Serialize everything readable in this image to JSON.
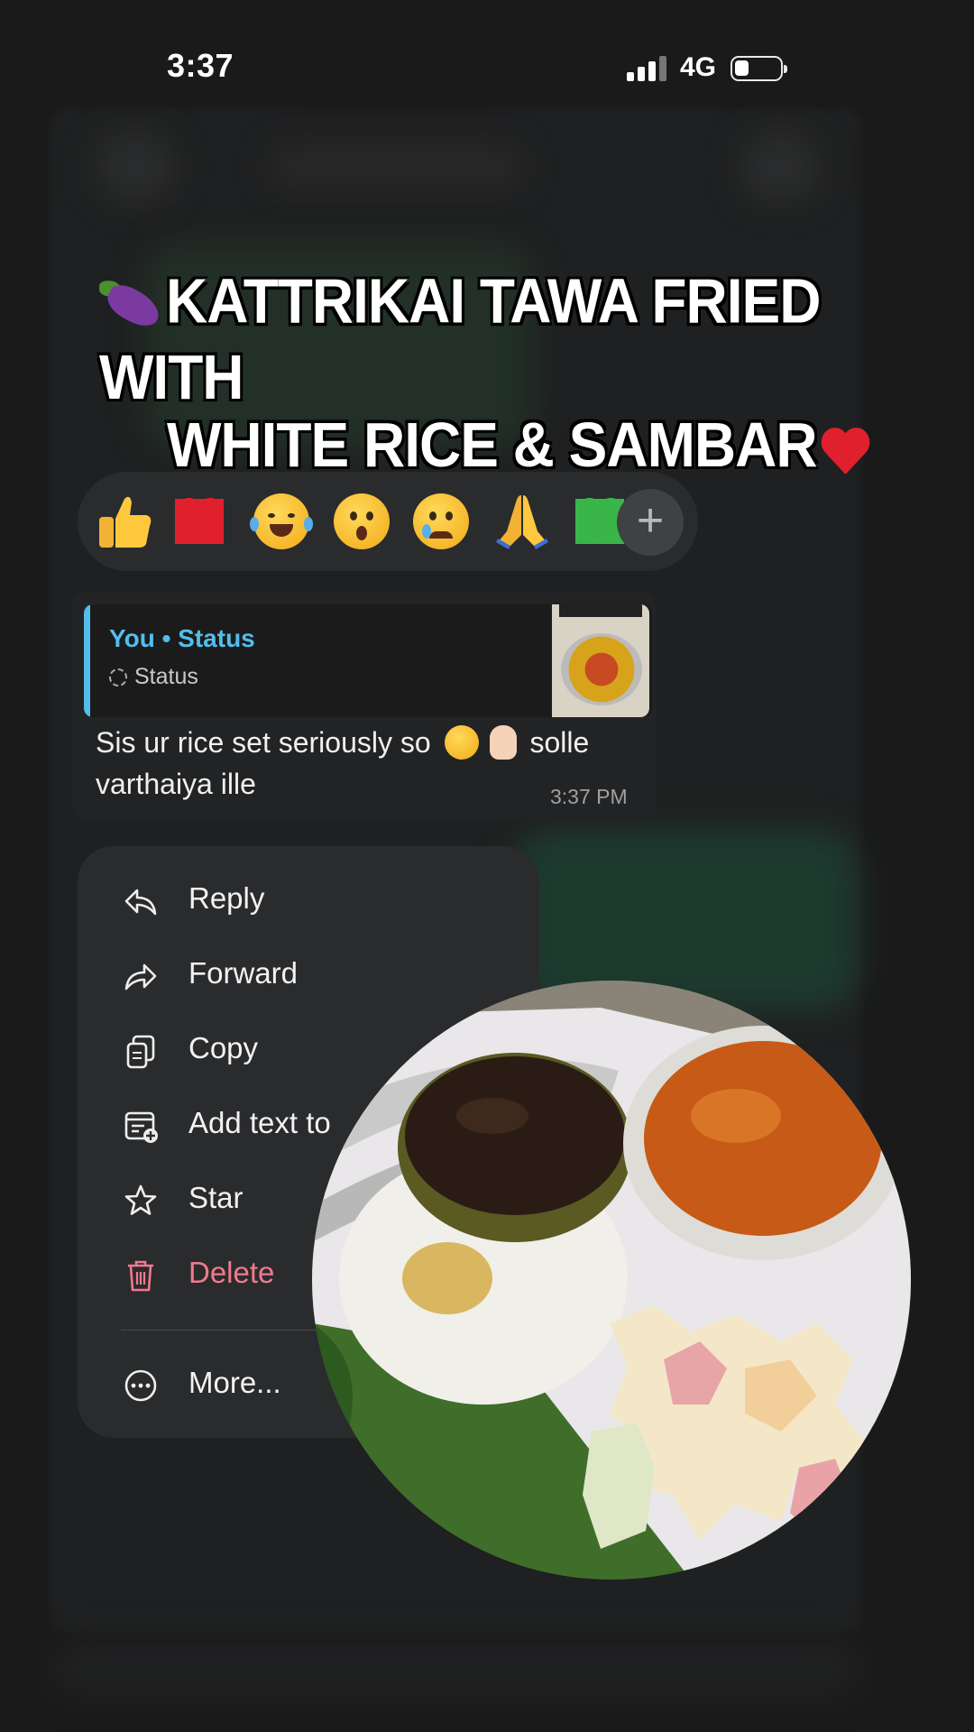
{
  "status_bar": {
    "time": "3:37",
    "network": "4G",
    "battery_level": 0.25
  },
  "title_overlay": {
    "line1": "Kattrikai Tawa Fried With",
    "line2": "White Rice & Sambar"
  },
  "reactions": {
    "items": [
      "thumbs-up",
      "red-heart",
      "tears-of-joy",
      "surprised",
      "crying",
      "folded-hands",
      "green-heart"
    ],
    "more_label": "+"
  },
  "message": {
    "quote_title": "You • Status",
    "quote_subtitle": "Status",
    "text_part1": "Sis ur rice set seriously so",
    "text_part2": "solle",
    "text_part3": "varthaiya ille",
    "time": "3:37 PM"
  },
  "menu": {
    "items": [
      {
        "label": "Reply",
        "icon": "reply-icon"
      },
      {
        "label": "Forward",
        "icon": "forward-icon"
      },
      {
        "label": "Copy",
        "icon": "copy-icon"
      },
      {
        "label": "Add text to ",
        "icon": "add-note-icon"
      },
      {
        "label": "Star",
        "icon": "star-icon"
      },
      {
        "label": "Delete",
        "icon": "trash-icon"
      },
      {
        "label": "More...",
        "icon": "more-icon"
      }
    ]
  },
  "colors": {
    "accent_blue": "#53bdeb",
    "delete_red": "#f07a8c",
    "menu_bg": "#2a2b2d"
  }
}
